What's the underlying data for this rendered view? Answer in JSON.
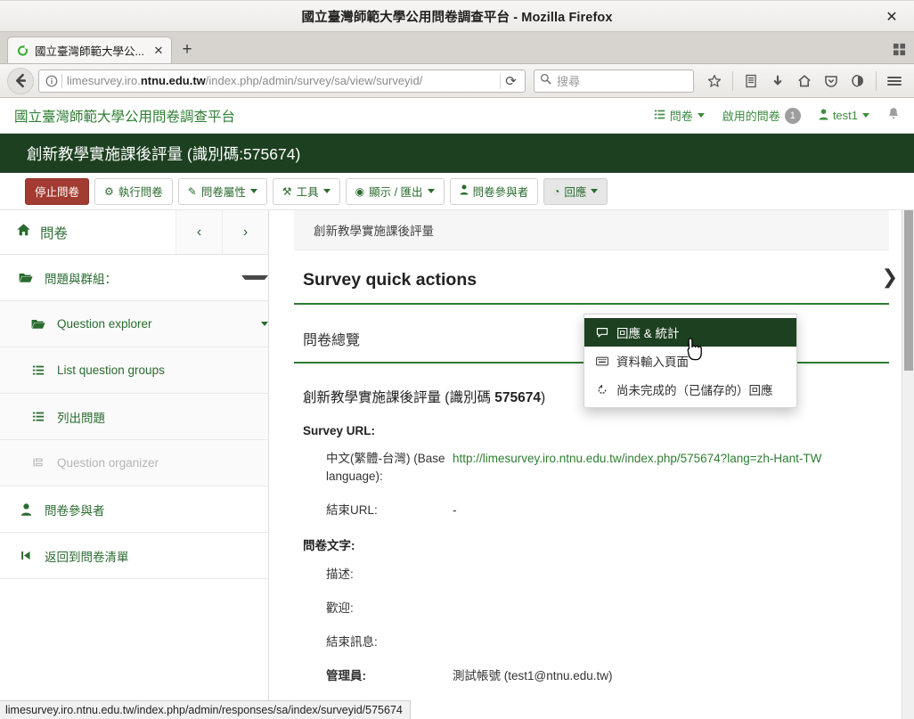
{
  "window": {
    "title": "國立臺灣師範大學公用問卷調查平台 - Mozilla Firefox",
    "close_label": "✕",
    "restore_icon": "restore-icon"
  },
  "browser": {
    "tab": {
      "title": "國立臺灣師範大學公...",
      "close_label": "✕",
      "favicon": "limesurvey-favicon"
    },
    "new_tab_label": "+",
    "url_plain_prefix": "limesurvey.iro.",
    "url_domain": "ntnu.edu.tw",
    "url_path": "/index.php/admin/survey/sa/view/surveyid/",
    "reload_label": "⟳",
    "search_placeholder": "搜尋",
    "icons": [
      "back-icon",
      "identity-icon",
      "reload-icon",
      "search-icon",
      "bookmark-star-icon",
      "library-icon",
      "downloads-icon",
      "home-icon",
      "pocket-icon",
      "sync-icon",
      "menu-icon"
    ]
  },
  "status_bar": {
    "link_preview": "limesurvey.iro.ntnu.edu.tw/index.php/admin/responses/sa/index/surveyid/575674"
  },
  "app": {
    "brand": "國立臺灣師範大學公用問卷調查平台",
    "nav": {
      "surveys_label": "問卷",
      "active_surveys_label": "啟用的問卷",
      "active_surveys_count": "1",
      "user_label": "test1",
      "bell_icon": "bell-icon"
    },
    "survey_banner": "創新教學實施課後評量 (識別碼:575674)",
    "toolbar": [
      {
        "label": "停止問卷",
        "icon": "",
        "style": "danger"
      },
      {
        "label": "執行問卷",
        "icon": "⚙",
        "style": "default"
      },
      {
        "label": "問卷屬性",
        "icon": "✎",
        "style": "default",
        "caret": true
      },
      {
        "label": "工具",
        "icon": "⚒",
        "style": "default",
        "caret": true
      },
      {
        "label": "顯示 / 匯出",
        "icon": "◉",
        "style": "default",
        "caret": true
      },
      {
        "label": "問卷參與者",
        "icon": "👤",
        "style": "default"
      },
      {
        "label": "回應",
        "icon": "◔",
        "style": "active",
        "caret": true
      }
    ],
    "dropdown": {
      "items": [
        {
          "label": "回應 & 統計",
          "icon": "💬",
          "selected": true
        },
        {
          "label": "資料輸入頁面",
          "icon": "⌨",
          "selected": false
        },
        {
          "label": "尚未完成的（已儲存的）回應",
          "icon": "↺",
          "selected": false
        }
      ]
    },
    "sidebar": {
      "home_label": "問卷",
      "prev_label": "‹",
      "next_label": "›",
      "items": [
        {
          "label": "問題與群組：",
          "icon": "folder-open-icon",
          "sub": false,
          "caret": true,
          "disabled": false
        },
        {
          "label": "Question explorer",
          "icon": "folder-open-icon",
          "sub": true,
          "caret_inline": true,
          "disabled": false
        },
        {
          "label": "List question groups",
          "icon": "list-icon",
          "sub": true,
          "disabled": false
        },
        {
          "label": "列出問題",
          "icon": "list-icon",
          "sub": true,
          "disabled": false
        },
        {
          "label": "Question organizer",
          "icon": "organizer-icon",
          "sub": true,
          "disabled": true
        },
        {
          "label": "問卷參與者",
          "icon": "user-icon",
          "sub": false,
          "disabled": false
        },
        {
          "label": "返回到問卷清單",
          "icon": "skip-back-icon",
          "sub": false,
          "disabled": false
        }
      ]
    },
    "main": {
      "breadcrumb": "創新教學實施課後評量",
      "quick_actions_title": "Survey quick actions",
      "overview_title": "問卷總覽",
      "overview_heading_plain": "創新教學實施課後評量 (識別碼 ",
      "overview_heading_bold": "575674",
      "overview_heading_suffix": ")",
      "survey_url_label": "Survey URL:",
      "base_language_label": "中文(繁體-台灣) (Base language):",
      "base_language_url": "http://limesurvey.iro.ntnu.edu.tw/index.php/575674?lang=zh-Hant-TW",
      "end_url_label": "結束URL:",
      "end_url_value": "-",
      "survey_text_label": "問卷文字:",
      "description_label": "描述:",
      "description_value": "",
      "welcome_label": "歡迎:",
      "welcome_value": "",
      "end_message_label": "結束訊息:",
      "end_message_value": "",
      "admin_label": "管理員:",
      "admin_value": "測試帳號 (test1@ntnu.edu.tw)",
      "expand_icon": "chevron-right-icon"
    }
  },
  "colors": {
    "brand_green": "#2e7d32",
    "dark_green": "#1d4020",
    "danger_red": "#a23b32",
    "link_green": "#2e7d32"
  }
}
